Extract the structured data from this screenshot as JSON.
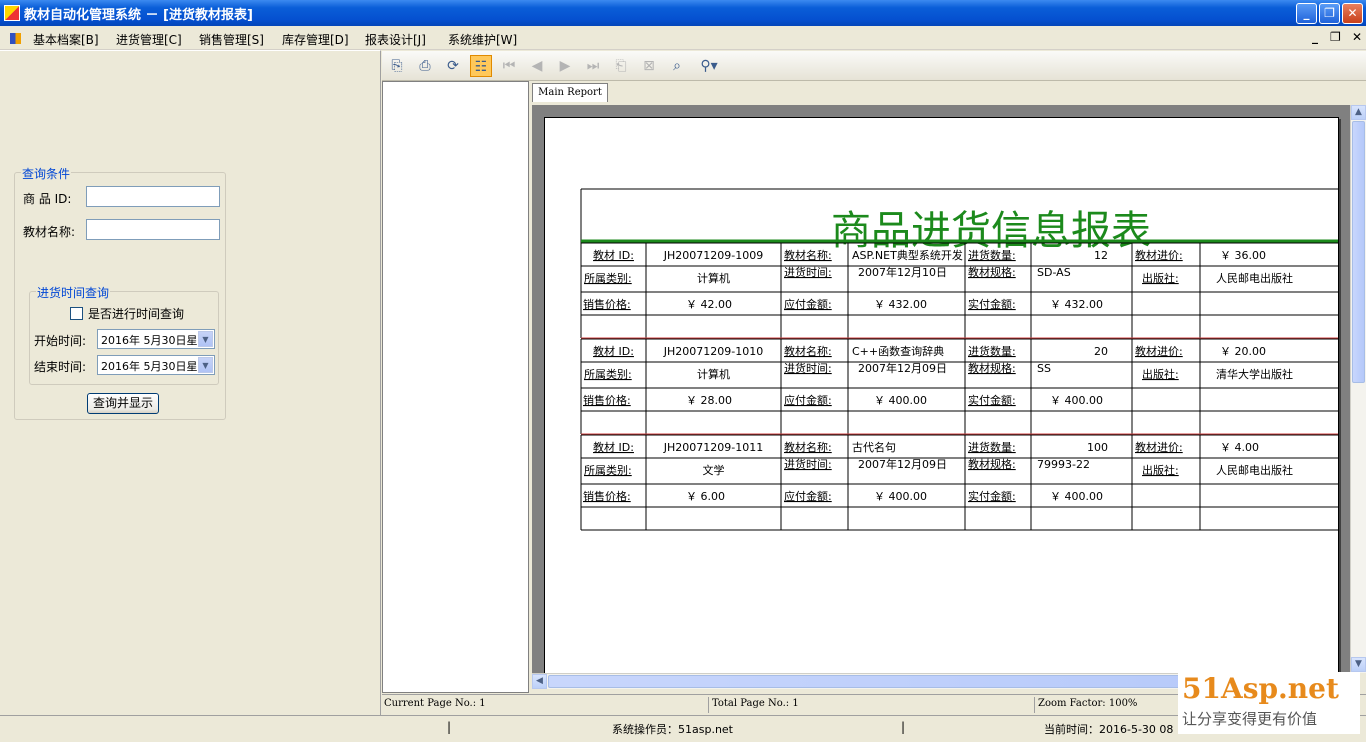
{
  "window": {
    "title": "教材自动化管理系统 － [进货教材报表]"
  },
  "menu": [
    "基本档案[B]",
    "进货管理[C]",
    "销售管理[S]",
    "库存管理[D]",
    "报表设计[J]",
    "系统维护[W]"
  ],
  "left": {
    "query_group": "查询条件",
    "goods_id_label": "商 品 ID:",
    "book_name_label": "教材名称:",
    "time_group": "进货时间查询",
    "check_label": "是否进行时间查询",
    "start_label": "开始时间:",
    "start_value": "2016年 5月30日星",
    "end_label": "结束时间:",
    "end_value": "2016年 5月30日星",
    "submit": "查询并显示"
  },
  "viewer": {
    "tab": "Main Report",
    "current_page": "Current Page No.: 1",
    "total_page": "Total Page No.: 1",
    "zoom": "Zoom Factor: 100%"
  },
  "report": {
    "title": "商品进货信息报表",
    "labels": {
      "id": "教材 ID:",
      "name": "教材名称:",
      "qty": "进货数量:",
      "price_in": "教材进价:",
      "category": "所属类别:",
      "date": "进货时间:",
      "spec": "教材规格:",
      "publisher": "出版社:",
      "sale_price": "销售价格:",
      "payable": "应付金额:",
      "paid": "实付金额:"
    },
    "records": [
      {
        "id": "JH20071209-1009",
        "name": "ASP.NET典型系统开发",
        "qty": "12",
        "price_in": "￥ 36.00",
        "category": "计算机",
        "date": "2007年12月10日",
        "spec": "SD-AS",
        "publisher": "人民邮电出版社",
        "sale_price": "￥ 42.00",
        "payable": "￥ 432.00",
        "paid": "￥ 432.00"
      },
      {
        "id": "JH20071209-1010",
        "name": "C++函数查询辞典",
        "qty": "20",
        "price_in": "￥ 20.00",
        "category": "计算机",
        "date": "2007年12月09日",
        "spec": "SS",
        "publisher": "清华大学出版社",
        "sale_price": "￥ 28.00",
        "payable": "￥ 400.00",
        "paid": "￥ 400.00"
      },
      {
        "id": "JH20071209-1011",
        "name": "古代名句",
        "qty": "100",
        "price_in": "￥ 4.00",
        "category": "文学",
        "date": "2007年12月09日",
        "spec": "79993-22",
        "publisher": "人民邮电出版社",
        "sale_price": "￥ 6.00",
        "payable": "￥ 400.00",
        "paid": "￥ 400.00"
      }
    ]
  },
  "status": {
    "operator": "系统操作员：51asp.net",
    "time": "当前时间：2016-5-30 08"
  },
  "watermark": {
    "logo": "51Asp.net",
    "tagline": "让分享变得更有价值"
  }
}
